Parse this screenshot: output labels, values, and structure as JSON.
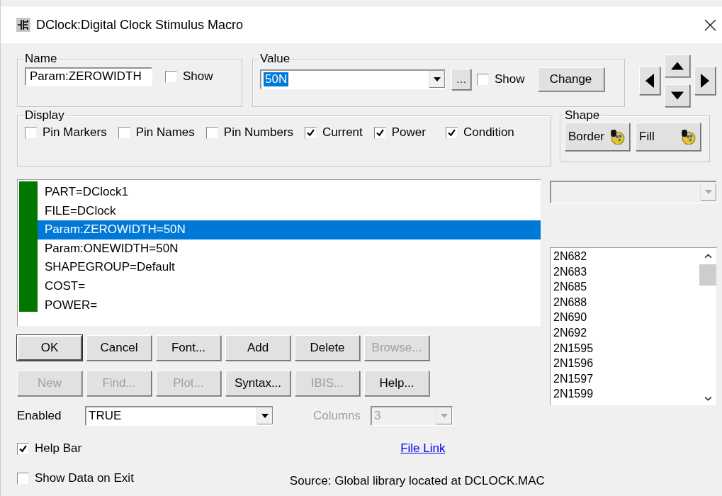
{
  "window": {
    "title": "DClock:Digital Clock Stimulus Macro"
  },
  "name_group": {
    "label": "Name",
    "value": "Param:ZEROWIDTH",
    "show_label": "Show",
    "show_checked": false
  },
  "value_group": {
    "label": "Value",
    "value": "50N",
    "value_selected": true,
    "browse_label": "...",
    "show_label": "Show",
    "show_checked": false,
    "change_label": "Change"
  },
  "display_group": {
    "label": "Display",
    "options": [
      {
        "label": "Pin Markers",
        "checked": false
      },
      {
        "label": "Pin Names",
        "checked": false
      },
      {
        "label": "Pin Numbers",
        "checked": false
      },
      {
        "label": "Current",
        "checked": true
      },
      {
        "label": "Power",
        "checked": true
      },
      {
        "label": "Condition",
        "checked": true
      }
    ]
  },
  "shape_group": {
    "label": "Shape",
    "buttons": [
      "Border",
      "Fill"
    ]
  },
  "attributes": [
    {
      "text": "PART=DClock1",
      "selected": false
    },
    {
      "text": "FILE=DClock",
      "selected": false
    },
    {
      "text": "Param:ZEROWIDTH=50N",
      "selected": true
    },
    {
      "text": "Param:ONEWIDTH=50N",
      "selected": false
    },
    {
      "text": "SHAPEGROUP=Default",
      "selected": false
    },
    {
      "text": "COST=",
      "selected": false
    },
    {
      "text": "POWER=",
      "selected": false
    }
  ],
  "part_list": [
    "2N682",
    "2N683",
    "2N685",
    "2N688",
    "2N690",
    "2N692",
    "2N1595",
    "2N1596",
    "2N1597",
    "2N1599"
  ],
  "button_rows": [
    [
      {
        "label": "OK",
        "disabled": false,
        "default": true
      },
      {
        "label": "Cancel",
        "disabled": false,
        "default": false
      },
      {
        "label": "Font...",
        "disabled": false,
        "default": false
      },
      {
        "label": "Add",
        "disabled": false,
        "default": false
      },
      {
        "label": "Delete",
        "disabled": false,
        "default": false
      },
      {
        "label": "Browse...",
        "disabled": true,
        "default": false
      }
    ],
    [
      {
        "label": "New",
        "disabled": true,
        "default": false
      },
      {
        "label": "Find...",
        "disabled": true,
        "default": false
      },
      {
        "label": "Plot...",
        "disabled": true,
        "default": false
      },
      {
        "label": "Syntax...",
        "disabled": false,
        "default": false
      },
      {
        "label": "IBIS...",
        "disabled": true,
        "default": false
      },
      {
        "label": "Help...",
        "disabled": false,
        "default": false
      }
    ]
  ],
  "enabled": {
    "label": "Enabled",
    "value": "TRUE"
  },
  "columns": {
    "label": "Columns",
    "value": "3",
    "disabled": true
  },
  "help_bar": {
    "label": "Help Bar",
    "checked": true
  },
  "show_data_on_exit": {
    "label": "Show Data on Exit",
    "checked": false
  },
  "file_link": "File Link",
  "source": "Source: Global library located at DCLOCK.MAC"
}
